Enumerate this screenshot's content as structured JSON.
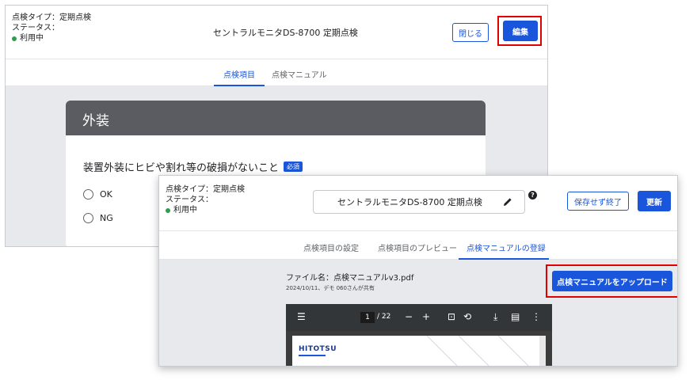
{
  "back_window": {
    "meta": {
      "type_line": "点検タイプ：定期点検",
      "status_label": "ステータス：",
      "status_value": "利用中"
    },
    "title": "セントラルモニタDS-8700 定期点検",
    "close_label": "閉じる",
    "edit_label": "編集",
    "tabs": [
      {
        "label": "点検項目",
        "active": true
      },
      {
        "label": "点検マニュアル",
        "active": false
      }
    ],
    "card": {
      "section_title": "外装",
      "question": "装置外装にヒビや割れ等の破損がないこと",
      "required_badge": "必須",
      "options": [
        "OK",
        "NG"
      ]
    }
  },
  "front_window": {
    "meta": {
      "type_line": "点検タイプ：定期点検",
      "status_label": "ステータス：",
      "status_value": "利用中"
    },
    "title_value": "セントラルモニタDS-8700 定期点検",
    "save_exit_label": "保存せず終了",
    "update_label": "更新",
    "tabs": [
      {
        "label": "点検項目の設定",
        "active": false
      },
      {
        "label": "点検項目のプレビュー",
        "active": false
      },
      {
        "label": "点検マニュアルの登録",
        "active": true
      }
    ],
    "file_name": "ファイル名：点検マニュアルv3.pdf",
    "file_sub": "2024/10/11、デモ 060さんが共有",
    "upload_label": "点検マニュアルをアップロード",
    "pdf": {
      "current_page": "1",
      "total_pages": "/ 22",
      "logo_text": "HITOTSU"
    }
  },
  "colors": {
    "accent": "#1a56db",
    "status_green": "#2e9d4f",
    "highlight_red": "#e00000",
    "card_header": "#5a5c61"
  },
  "icons": [
    "pencil-icon",
    "help-icon",
    "menu-icon",
    "zoom-out-icon",
    "zoom-in-icon",
    "fit-page-icon",
    "rotate-icon",
    "download-icon",
    "print-icon",
    "more-icon"
  ]
}
